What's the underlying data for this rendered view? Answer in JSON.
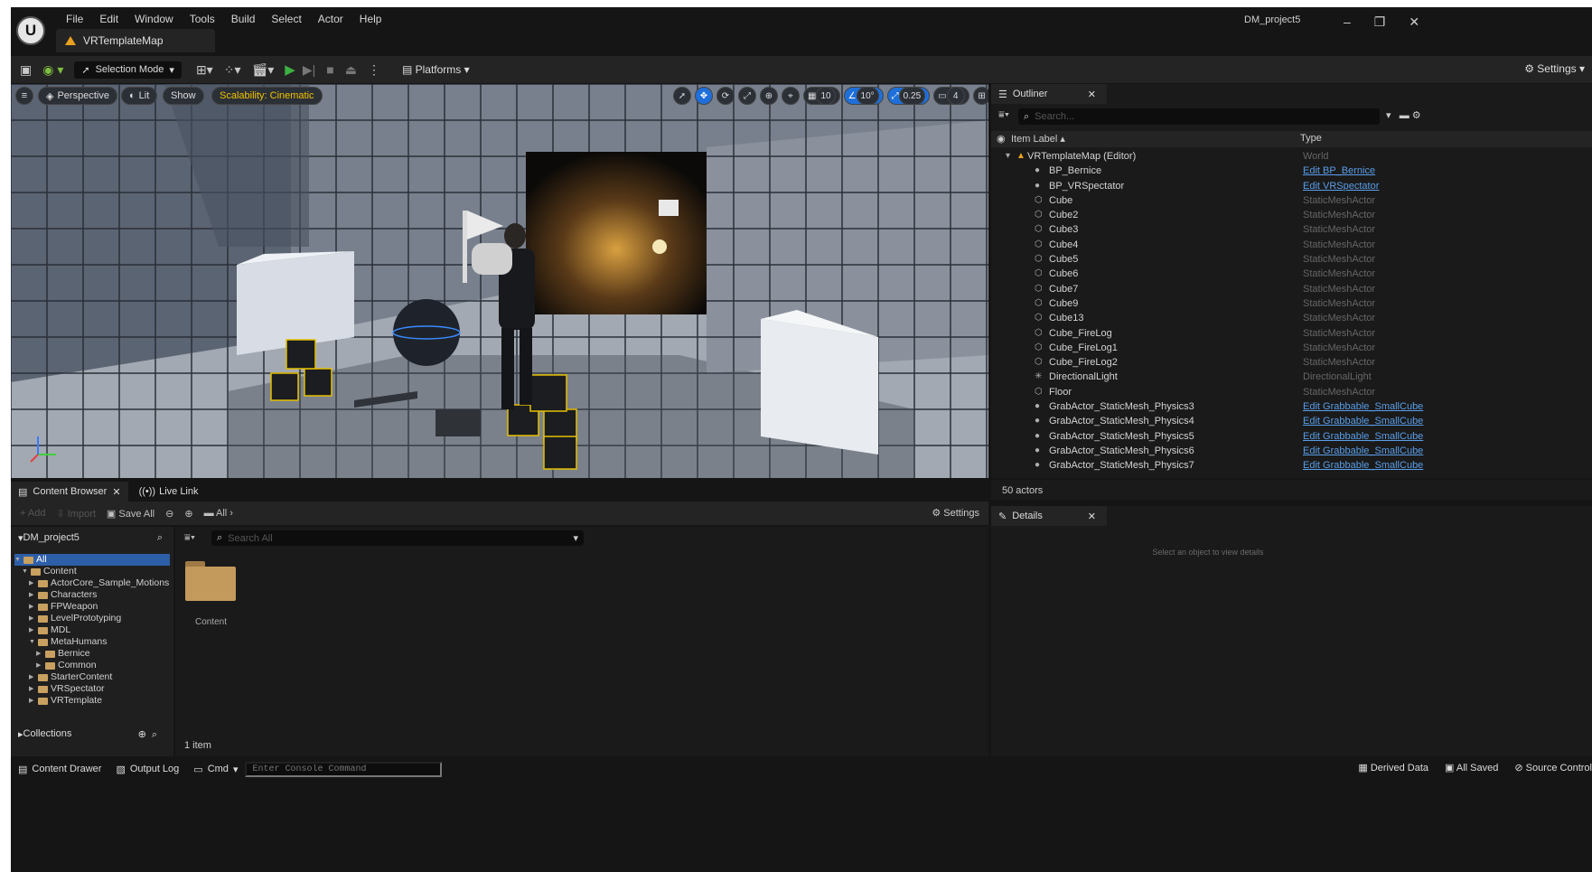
{
  "window": {
    "project_name": "DM_project5",
    "map_tab": "VRTemplateMap",
    "min": "–",
    "max": "❐",
    "close": "✕"
  },
  "menu": [
    "File",
    "Edit",
    "Window",
    "Tools",
    "Build",
    "Select",
    "Actor",
    "Help"
  ],
  "toolbar": {
    "selection_mode": "Selection Mode",
    "platforms": "Platforms",
    "settings": "Settings"
  },
  "viewport": {
    "perspective": "Perspective",
    "lit": "Lit",
    "show": "Show",
    "scalability": "Scalability: Cinematic",
    "grid_snap": "10",
    "rot_snap": "10°",
    "scale_snap": "0.25",
    "cam_speed": "4"
  },
  "outliner": {
    "tab": "Outliner",
    "search_placeholder": "Search...",
    "col_label": "Item Label ▴",
    "col_type": "Type",
    "world": {
      "label": "VRTemplateMap (Editor)",
      "type": "World"
    },
    "rows": [
      {
        "label": "BP_Bernice",
        "type": "Edit BP_Bernice",
        "link": true
      },
      {
        "label": "BP_VRSpectator",
        "type": "Edit VRSpectator",
        "link": true
      },
      {
        "label": "Cube",
        "type": "StaticMeshActor",
        "link": false
      },
      {
        "label": "Cube2",
        "type": "StaticMeshActor",
        "link": false
      },
      {
        "label": "Cube3",
        "type": "StaticMeshActor",
        "link": false
      },
      {
        "label": "Cube4",
        "type": "StaticMeshActor",
        "link": false
      },
      {
        "label": "Cube5",
        "type": "StaticMeshActor",
        "link": false
      },
      {
        "label": "Cube6",
        "type": "StaticMeshActor",
        "link": false
      },
      {
        "label": "Cube7",
        "type": "StaticMeshActor",
        "link": false
      },
      {
        "label": "Cube9",
        "type": "StaticMeshActor",
        "link": false
      },
      {
        "label": "Cube13",
        "type": "StaticMeshActor",
        "link": false
      },
      {
        "label": "Cube_FireLog",
        "type": "StaticMeshActor",
        "link": false
      },
      {
        "label": "Cube_FireLog1",
        "type": "StaticMeshActor",
        "link": false
      },
      {
        "label": "Cube_FireLog2",
        "type": "StaticMeshActor",
        "link": false
      },
      {
        "label": "DirectionalLight",
        "type": "DirectionalLight",
        "link": false
      },
      {
        "label": "Floor",
        "type": "StaticMeshActor",
        "link": false
      },
      {
        "label": "GrabActor_StaticMesh_Physics3",
        "type": "Edit Grabbable_SmallCube",
        "link": true
      },
      {
        "label": "GrabActor_StaticMesh_Physics4",
        "type": "Edit Grabbable_SmallCube",
        "link": true
      },
      {
        "label": "GrabActor_StaticMesh_Physics5",
        "type": "Edit Grabbable_SmallCube",
        "link": true
      },
      {
        "label": "GrabActor_StaticMesh_Physics6",
        "type": "Edit Grabbable_SmallCube",
        "link": true
      },
      {
        "label": "GrabActor_StaticMesh_Physics7",
        "type": "Edit Grabbable_SmallCube",
        "link": true
      }
    ],
    "actor_count": "50 actors"
  },
  "details": {
    "tab": "Details",
    "empty": "Select an object to view details"
  },
  "content_browser": {
    "tab": "Content Browser",
    "live_link": "Live Link",
    "add": "Add",
    "import": "Import",
    "save_all": "Save All",
    "path": "All",
    "settings": "Settings",
    "project": "DM_project5",
    "search_placeholder": "Search All",
    "folder": "Content",
    "item_count": "1 item",
    "collections": "Collections",
    "tree": [
      {
        "label": "All",
        "depth": 0,
        "open": true,
        "sel": true
      },
      {
        "label": "Content",
        "depth": 1,
        "open": true
      },
      {
        "label": "ActorCore_Sample_Motions",
        "depth": 2
      },
      {
        "label": "Characters",
        "depth": 2
      },
      {
        "label": "FPWeapon",
        "depth": 2
      },
      {
        "label": "LevelPrototyping",
        "depth": 2
      },
      {
        "label": "MDL",
        "depth": 2
      },
      {
        "label": "MetaHumans",
        "depth": 2,
        "open": true
      },
      {
        "label": "Bernice",
        "depth": 3
      },
      {
        "label": "Common",
        "depth": 3
      },
      {
        "label": "StarterContent",
        "depth": 2
      },
      {
        "label": "VRSpectator",
        "depth": 2
      },
      {
        "label": "VRTemplate",
        "depth": 2
      }
    ]
  },
  "status": {
    "content_drawer": "Content Drawer",
    "output_log": "Output Log",
    "cmd": "Cmd",
    "console_placeholder": "Enter Console Command",
    "derived_data": "Derived Data",
    "all_saved": "All Saved",
    "source_control": "Source Control"
  }
}
